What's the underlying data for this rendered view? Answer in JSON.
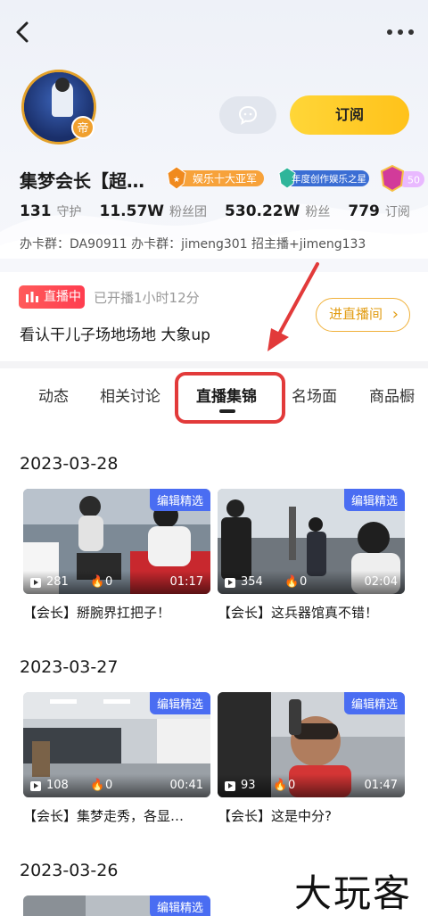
{
  "profile": {
    "name": "集梦会长【超…",
    "avatar_badge": "帝",
    "subscribe_label": "订阅",
    "medals": [
      "娱乐十大亚军",
      "年度创作娱乐之星",
      "50"
    ],
    "stats": [
      {
        "value": "131",
        "label": "守护"
      },
      {
        "value": "11.57W",
        "label": "粉丝团"
      },
      {
        "value": "530.22W",
        "label": "粉丝"
      },
      {
        "value": "779",
        "label": "订阅"
      }
    ],
    "groups": "办卡群：DA90911 办卡群：jimeng301 招主播+jimeng133"
  },
  "live": {
    "badge": "直播中",
    "time": "已开播1小时12分",
    "title": "看认干儿子场地场地 大象up",
    "enter_label": "进直播间"
  },
  "tabs": [
    "动态",
    "相关讨论",
    "直播集锦",
    "名场面",
    "商品橱"
  ],
  "active_tab": "直播集锦",
  "sections": [
    {
      "date": "2023-03-28",
      "videos": [
        {
          "tag": "编辑精选",
          "views": "281",
          "likes": "0",
          "duration": "01:17",
          "title": "【会长】掰腕界扛把子！"
        },
        {
          "tag": "编辑精选",
          "views": "354",
          "likes": "0",
          "duration": "02:04",
          "title": "【会长】这兵器馆真不错！"
        }
      ]
    },
    {
      "date": "2023-03-27",
      "videos": [
        {
          "tag": "编辑精选",
          "views": "108",
          "likes": "0",
          "duration": "00:41",
          "title": "【会长】集梦走秀，各显…"
        },
        {
          "tag": "编辑精选",
          "views": "93",
          "likes": "0",
          "duration": "01:47",
          "title": "【会长】这是中分?"
        }
      ]
    },
    {
      "date": "2023-03-26",
      "videos": [
        {
          "tag": "编辑精选"
        }
      ]
    }
  ],
  "watermark": "大玩客",
  "colors": {
    "accent": "#ffc21a",
    "live": "#ff3d4f",
    "tag": "#4a6df2",
    "annotation": "#e23a3a"
  }
}
